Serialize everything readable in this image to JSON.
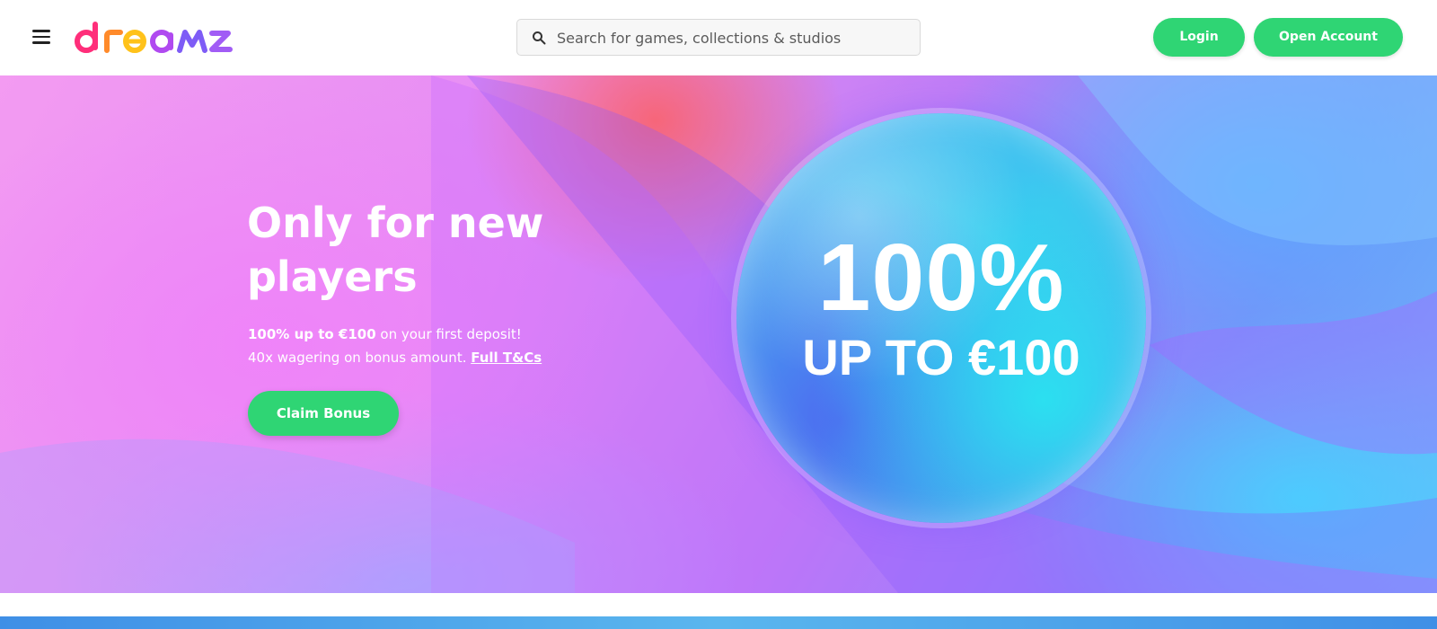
{
  "header": {
    "brand": "dreamz",
    "search": {
      "placeholder": "Search for games, collections & studios",
      "value": ""
    },
    "login_label": "Login",
    "open_account_label": "Open Account"
  },
  "hero": {
    "title": "Only for new players",
    "offer_bold": "100% up to €100",
    "offer_rest": " on your first deposit!",
    "wagering": "40x wagering on bonus amount. ",
    "tc_link": "Full T&Cs",
    "claim_label": "Claim Bonus",
    "bubble_big": "100%",
    "bubble_small": "UP TO €100"
  },
  "colors": {
    "accent_green": "#2fd574",
    "hero_pink": "#e58cf4",
    "hero_blue": "#67c0f8"
  },
  "icons": [
    "hamburger-menu-icon",
    "search-icon"
  ]
}
